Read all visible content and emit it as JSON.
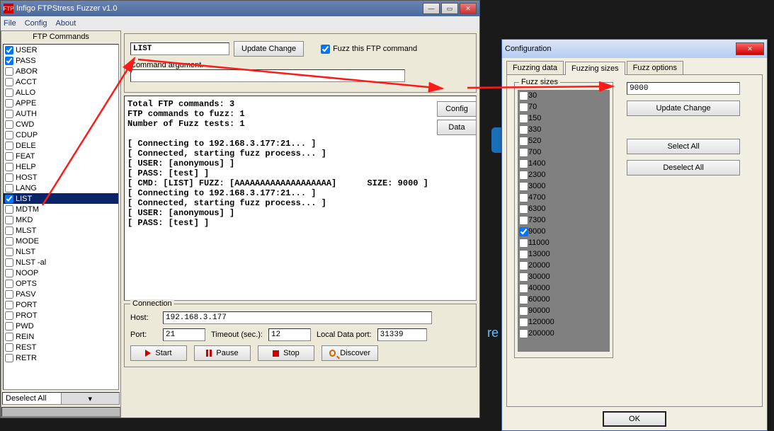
{
  "main": {
    "title": "Infigo FTPStress Fuzzer v1.0",
    "icon_text": "FTP",
    "menu": [
      "File",
      "Config",
      "About"
    ],
    "left": {
      "title": "FTP Commands",
      "items": [
        {
          "label": "USER",
          "checked": true
        },
        {
          "label": "PASS",
          "checked": true
        },
        {
          "label": "ABOR",
          "checked": false
        },
        {
          "label": "ACCT",
          "checked": false
        },
        {
          "label": "ALLO",
          "checked": false
        },
        {
          "label": "APPE",
          "checked": false
        },
        {
          "label": "AUTH",
          "checked": false
        },
        {
          "label": "CWD",
          "checked": false
        },
        {
          "label": "CDUP",
          "checked": false
        },
        {
          "label": "DELE",
          "checked": false
        },
        {
          "label": "FEAT",
          "checked": false
        },
        {
          "label": "HELP",
          "checked": false
        },
        {
          "label": "HOST",
          "checked": false
        },
        {
          "label": "LANG",
          "checked": false
        },
        {
          "label": "LIST",
          "checked": true,
          "selected": true
        },
        {
          "label": "MDTM",
          "checked": false
        },
        {
          "label": "MKD",
          "checked": false
        },
        {
          "label": "MLST",
          "checked": false
        },
        {
          "label": "MODE",
          "checked": false
        },
        {
          "label": "NLST",
          "checked": false
        },
        {
          "label": "NLST -al",
          "checked": false
        },
        {
          "label": "NOOP",
          "checked": false
        },
        {
          "label": "OPTS",
          "checked": false
        },
        {
          "label": "PASV",
          "checked": false
        },
        {
          "label": "PORT",
          "checked": false
        },
        {
          "label": "PROT",
          "checked": false
        },
        {
          "label": "PWD",
          "checked": false
        },
        {
          "label": "REIN",
          "checked": false
        },
        {
          "label": "REST",
          "checked": false
        },
        {
          "label": "RETR",
          "checked": false
        }
      ],
      "combo": "Deselect All"
    },
    "cmd": {
      "value": "LIST",
      "update": "Update Change",
      "fuzz_checkbox": "Fuzz this FTP command",
      "fuzz_checked": true,
      "arg_label": "Command argument.",
      "arg_value": ""
    },
    "side": {
      "config": "Config",
      "data": "Data"
    },
    "log_lines": [
      "Total FTP commands: 3",
      "FTP commands to fuzz: 1",
      "Number of Fuzz tests: 1",
      "",
      "[ Connecting to 192.168.3.177:21... ]",
      "[ Connected, starting fuzz process... ]",
      "[ USER: [anonymous] ]",
      "[ PASS: [test] ]",
      "[ CMD: [LIST] FUZZ: [AAAAAAAAAAAAAAAAAAA]      SIZE: 9000 ]",
      "[ Connecting to 192.168.3.177:21... ]",
      "[ Connected, starting fuzz process... ]",
      "[ USER: [anonymous] ]",
      "[ PASS: [test] ]"
    ],
    "conn": {
      "legend": "Connection",
      "host_label": "Host:",
      "host": "192.168.3.177",
      "port_label": "Port:",
      "port": "21",
      "timeout_label": "Timeout (sec.):",
      "timeout": "12",
      "localport_label": "Local Data port:",
      "localport": "31339"
    },
    "ctrl": {
      "start": "Start",
      "pause": "Pause",
      "stop": "Stop",
      "discover": "Discover"
    }
  },
  "config": {
    "title": "Configuration",
    "tabs": [
      "Fuzzing data",
      "Fuzzing sizes",
      "Fuzz options"
    ],
    "active_tab": 1,
    "fuzz_sizes_legend": "Fuzz sizes",
    "sizes": [
      {
        "v": "30",
        "c": false
      },
      {
        "v": "70",
        "c": false
      },
      {
        "v": "150",
        "c": false
      },
      {
        "v": "330",
        "c": false
      },
      {
        "v": "520",
        "c": false
      },
      {
        "v": "700",
        "c": false
      },
      {
        "v": "1400",
        "c": false
      },
      {
        "v": "2300",
        "c": false
      },
      {
        "v": "3000",
        "c": false
      },
      {
        "v": "4700",
        "c": false
      },
      {
        "v": "6300",
        "c": false
      },
      {
        "v": "7300",
        "c": false
      },
      {
        "v": "9000",
        "c": true
      },
      {
        "v": "11000",
        "c": false
      },
      {
        "v": "13000",
        "c": false
      },
      {
        "v": "20000",
        "c": false
      },
      {
        "v": "30000",
        "c": false
      },
      {
        "v": "40000",
        "c": false
      },
      {
        "v": "60000",
        "c": false
      },
      {
        "v": "90000",
        "c": false
      },
      {
        "v": "120000",
        "c": false
      },
      {
        "v": "200000",
        "c": false
      }
    ],
    "value_input": "9000",
    "update": "Update Change",
    "select_all": "Select All",
    "deselect_all": "Deselect All",
    "ok": "OK"
  },
  "desktop_hint": "re"
}
